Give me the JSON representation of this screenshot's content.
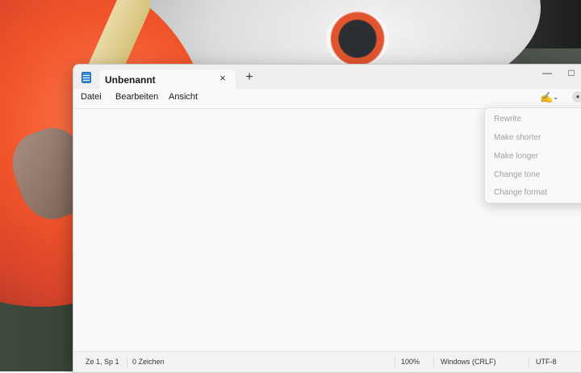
{
  "window": {
    "tab_title": "Unbenannt",
    "tab_close_icon": "×",
    "new_tab_icon": "+",
    "minimize_icon": "—",
    "maximize_icon": "□"
  },
  "menu": {
    "items": [
      "Datei",
      "Bearbeiten",
      "Ansicht"
    ]
  },
  "toolbar": {
    "copilot_icon": "✍",
    "copilot_chevron": "⌄",
    "account_icon": "●"
  },
  "copilot_menu": {
    "items": [
      "Rewrite",
      "Make shorter",
      "Make longer",
      "Change tone",
      "Change format"
    ],
    "disabled": true
  },
  "status": {
    "position": "Ze 1, Sp 1",
    "characters": "0 Zeichen",
    "zoom": "100%",
    "line_ending": "Windows (CRLF)",
    "encoding": "UTF-8"
  },
  "colors": {
    "accent_icon": "#3a8dd6",
    "disabled_text": "#a0a0a0"
  }
}
